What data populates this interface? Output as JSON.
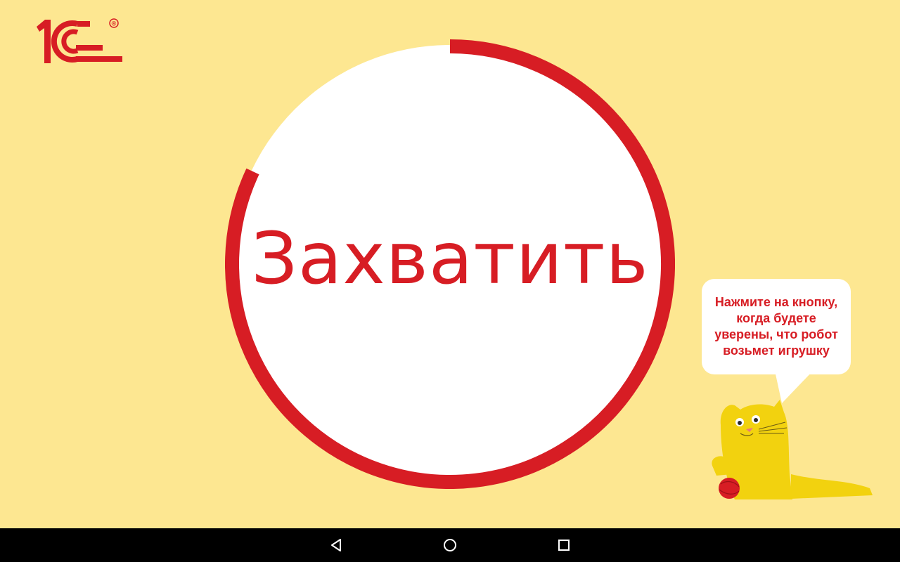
{
  "logo": {
    "text": "1С",
    "registered_mark": "®"
  },
  "main": {
    "grab_button_label": "Захватить",
    "timer_progress_fraction": 0.82
  },
  "hint": {
    "text": "Нажмите на кнопку, когда будете уверены, что робот возьмет игрушку"
  },
  "colors": {
    "background": "#fde791",
    "accent": "#d71d24",
    "button_fill": "#ffffff",
    "navbar": "#000000"
  },
  "navbar": {
    "back_icon": "triangle-back-icon",
    "home_icon": "circle-home-icon",
    "recent_icon": "square-recent-icon"
  }
}
